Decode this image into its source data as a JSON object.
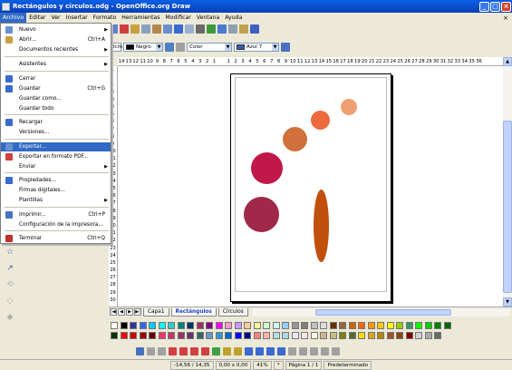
{
  "window": {
    "title": "Rectángulos y círculos.odg - OpenOffice.org Draw",
    "btn_min": "_",
    "btn_max": "□",
    "btn_close": "×"
  },
  "menubar": {
    "items": [
      "Archivo",
      "Editar",
      "Ver",
      "Insertar",
      "Formato",
      "Herramientas",
      "Modificar",
      "Ventana",
      "Ayuda"
    ],
    "close_doc": "×"
  },
  "file_menu": {
    "items": [
      {
        "label": "Nuevo",
        "shortcut": "",
        "submenu": true
      },
      {
        "label": "Abrir...",
        "shortcut": "Ctrl+A",
        "submenu": false
      },
      {
        "label": "Documentos recientes",
        "shortcut": "",
        "submenu": true
      },
      {
        "label": "Asistentes",
        "shortcut": "",
        "submenu": true
      },
      {
        "label": "Cerrar",
        "shortcut": "",
        "submenu": false
      },
      {
        "label": "Guardar",
        "shortcut": "Ctrl+G",
        "submenu": false
      },
      {
        "label": "Guardar como...",
        "shortcut": "",
        "submenu": false
      },
      {
        "label": "Guardar todo",
        "shortcut": "",
        "submenu": false
      },
      {
        "label": "Recargar",
        "shortcut": "",
        "submenu": false
      },
      {
        "label": "Versiones...",
        "shortcut": "",
        "submenu": false
      },
      {
        "label": "Exportar...",
        "shortcut": "",
        "submenu": false
      },
      {
        "label": "Exportar en formato PDF...",
        "shortcut": "",
        "submenu": false
      },
      {
        "label": "Enviar",
        "shortcut": "",
        "submenu": true
      },
      {
        "label": "Propiedades...",
        "shortcut": "",
        "submenu": false
      },
      {
        "label": "Firmas digitales...",
        "shortcut": "",
        "submenu": false
      },
      {
        "label": "Plantillas",
        "shortcut": "",
        "submenu": true
      },
      {
        "label": "Imprimir...",
        "shortcut": "Ctrl+P",
        "submenu": false
      },
      {
        "label": "Configuración de la impresora...",
        "shortcut": "",
        "submenu": false
      },
      {
        "label": "Terminar",
        "shortcut": "Ctrl+Q",
        "submenu": false
      }
    ],
    "highlighted_index": 10
  },
  "line_toolbar": {
    "width_value": "0cm",
    "line_color": "Negro",
    "area_style": "Color",
    "area_color": "Azul 7"
  },
  "ruler": {
    "top_labels": [
      "14",
      "13",
      "12",
      "11",
      "10",
      "9",
      "8",
      "7",
      "6",
      "5",
      "4",
      "3",
      "2",
      "1",
      "",
      "1",
      "2",
      "3",
      "4",
      "5",
      "6",
      "7",
      "8",
      "9",
      "10",
      "11",
      "12",
      "13",
      "14",
      "15",
      "16",
      "17",
      "18",
      "19",
      "20",
      "21",
      "22",
      "23",
      "24",
      "25",
      "26",
      "27",
      "28",
      "29",
      "30",
      "31",
      "32",
      "33",
      "34",
      "35",
      "36"
    ],
    "left_labels": [
      "1",
      "",
      "1",
      "2",
      "3",
      "4",
      "5",
      "6",
      "7",
      "8",
      "9",
      "10",
      "11",
      "12",
      "13",
      "14",
      "15",
      "16",
      "17",
      "18",
      "19",
      "20",
      "21",
      "22",
      "23",
      "24",
      "25",
      "26",
      "27",
      "28",
      "29",
      "30"
    ]
  },
  "tabs": {
    "nav": [
      "|◀",
      "◀",
      "▶",
      "▶|"
    ],
    "items": [
      "Capa1",
      "Rectángulos",
      "Círculos"
    ],
    "active_index": 1
  },
  "status": {
    "position": "-14,56 / 14,35",
    "size": "0,00 x 0,00",
    "zoom": "41%",
    "modified": "*",
    "page": "Página 1 / 1",
    "style": "Predeterminado"
  },
  "shapes": [
    {
      "name": "circle-small-orange",
      "color": "#f0a070"
    },
    {
      "name": "circle-orange",
      "color": "#ec6a3c"
    },
    {
      "name": "circle-brown-orange",
      "color": "#d0703c"
    },
    {
      "name": "circle-crimson",
      "color": "#c01848"
    },
    {
      "name": "circle-maroon",
      "color": "#a02848"
    },
    {
      "name": "ellipse-rust",
      "color": "#c0500c"
    }
  ],
  "palette_colors": [
    "#ffffff",
    "#000000",
    "#333399",
    "#3366ff",
    "#00ccff",
    "#00ffff",
    "#33cccc",
    "#008080",
    "#003366",
    "#993366",
    "#800080",
    "#ff00ff",
    "#ff99cc",
    "#cc99ff",
    "#ffcc99",
    "#ffff99",
    "#ccffcc",
    "#ccffff",
    "#99ccff",
    "#969696",
    "#808080",
    "#c0c0c0",
    "#dddddd",
    "#663300",
    "#996633",
    "#cc6600",
    "#ff6600",
    "#ff9900",
    "#ffcc00",
    "#ffff00",
    "#99cc00",
    "#339966",
    "#00ff00",
    "#00cc00",
    "#008000",
    "#006600",
    "#003300",
    "#ff0000",
    "#cc0000",
    "#990000",
    "#660000",
    "#ff3366",
    "#cc3366",
    "#993366",
    "#663366",
    "#336666",
    "#6699cc",
    "#3399cc",
    "#0066cc",
    "#0000ff",
    "#000080",
    "#ff8080",
    "#ffb0b0",
    "#b0e0e6",
    "#add8e6",
    "#e6e6fa",
    "#ffe4e1",
    "#f5f5dc",
    "#d2b48c",
    "#c0c080",
    "#808000",
    "#556b2f",
    "#ffd700",
    "#daa520",
    "#b8860b",
    "#a0522d",
    "#8b4513",
    "#800000",
    "#d3d3d3",
    "#a9a9a9",
    "#696969"
  ]
}
